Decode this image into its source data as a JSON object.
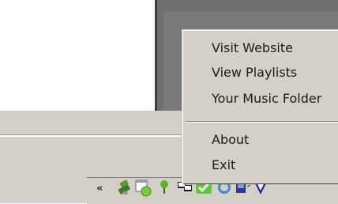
{
  "context_menu": {
    "items": [
      {
        "label": "Visit Website"
      },
      {
        "label": "View Playlists"
      },
      {
        "label": "Your Music Folder"
      },
      {
        "label": "About"
      },
      {
        "label": "Exit"
      }
    ]
  },
  "tray": {
    "expand_label": "«",
    "icons": [
      "usb-plug-icon",
      "window-green-circle-icon",
      "green-pin-icon",
      "network-icon",
      "green-check-icon",
      "sync-icon",
      "device-icon",
      "shield-icon"
    ]
  },
  "colors": {
    "menu_bg": "#d4d0c8",
    "dark_window": "#6f6f6f"
  }
}
